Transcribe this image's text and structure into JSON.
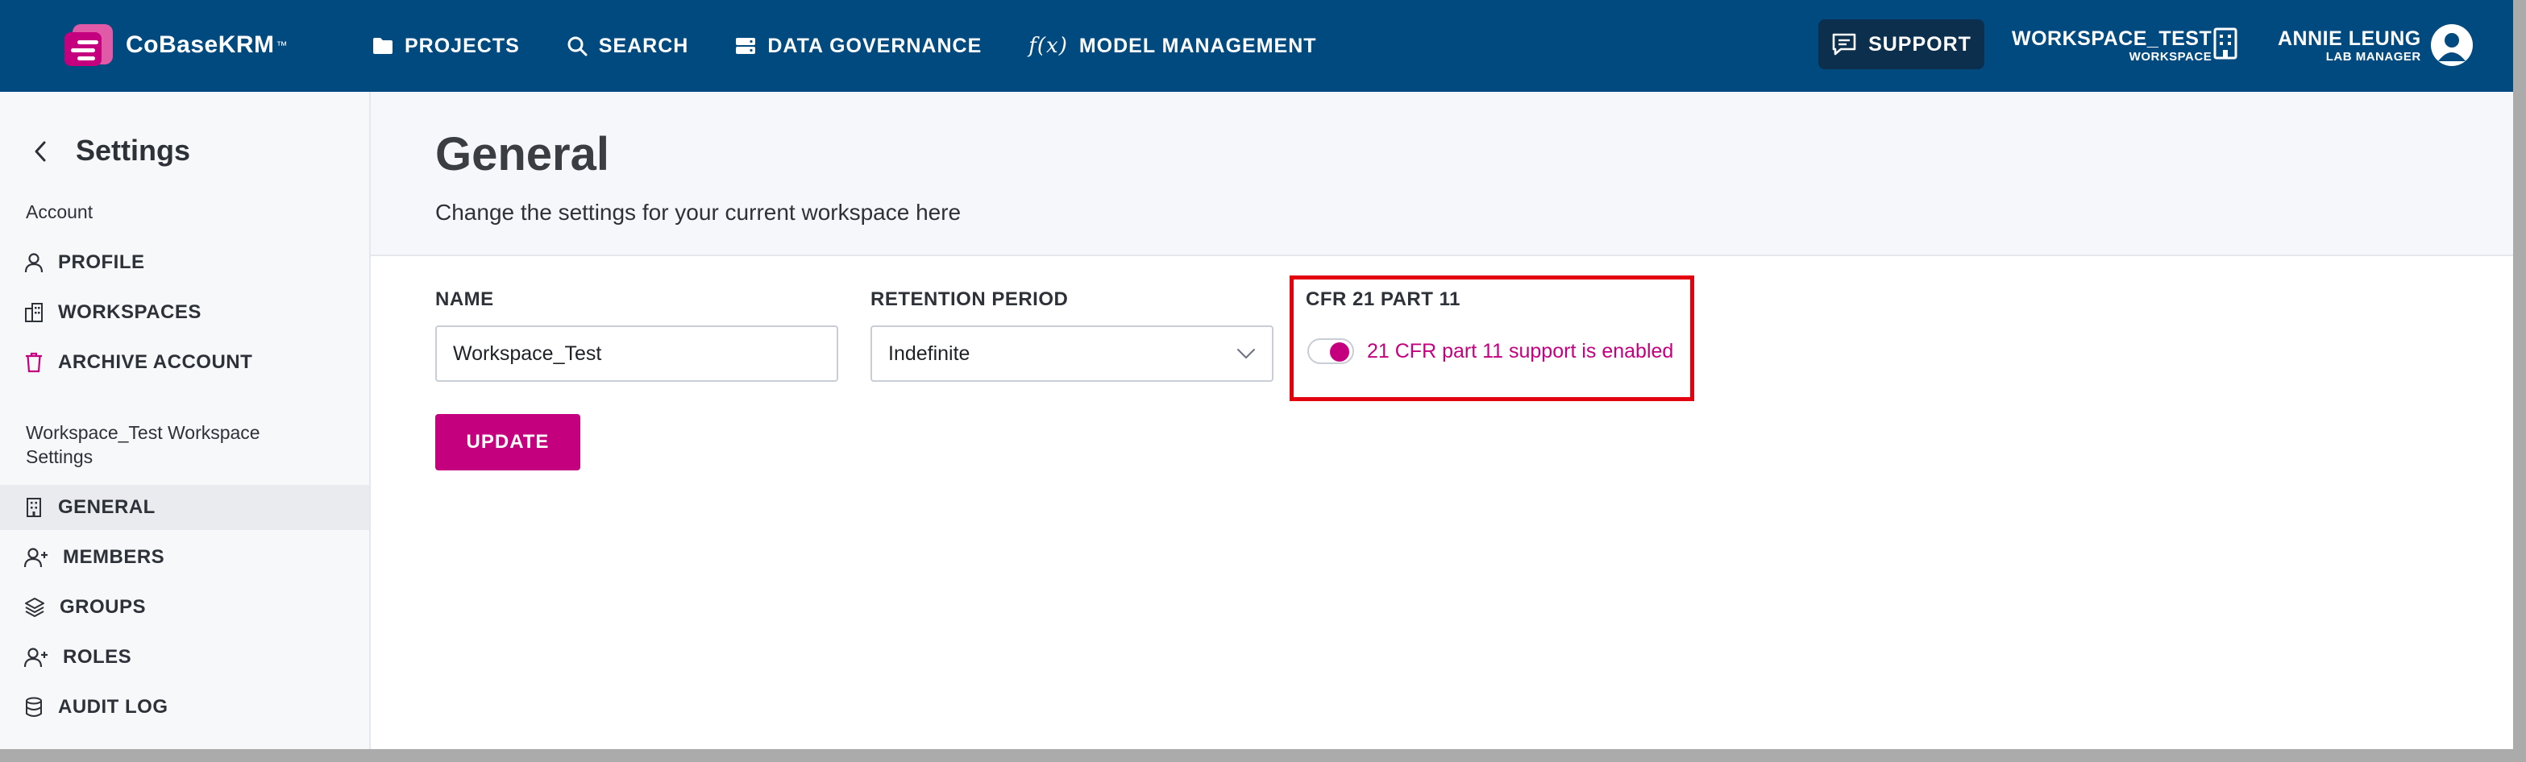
{
  "brand": {
    "name": "CoBaseKRM",
    "trademark": "™"
  },
  "nav": [
    {
      "label": "PROJECTS",
      "icon": "folder-icon"
    },
    {
      "label": "SEARCH",
      "icon": "search-icon"
    },
    {
      "label": "DATA GOVERNANCE",
      "icon": "database-icon"
    },
    {
      "label": "MODEL MANAGEMENT",
      "icon": "function-icon",
      "glyph": "f(x)"
    }
  ],
  "support": {
    "label": "SUPPORT",
    "icon": "chat-icon"
  },
  "workspace": {
    "name": "WORKSPACE_TEST",
    "sub": "WORKSPACE",
    "icon": "building-icon"
  },
  "user": {
    "name": "ANNIE LEUNG",
    "role": "LAB MANAGER"
  },
  "sidebar": {
    "title": "Settings",
    "account_heading": "Account",
    "account_items": [
      {
        "label": "PROFILE",
        "icon": "user-icon"
      },
      {
        "label": "WORKSPACES",
        "icon": "buildings-icon"
      },
      {
        "label": "ARCHIVE ACCOUNT",
        "icon": "trash-icon"
      }
    ],
    "workspace_heading": "Workspace_Test Workspace Settings",
    "workspace_items": [
      {
        "label": "GENERAL",
        "icon": "building-icon",
        "active": true
      },
      {
        "label": "MEMBERS",
        "icon": "user-plus-icon"
      },
      {
        "label": "GROUPS",
        "icon": "layers-icon"
      },
      {
        "label": "ROLES",
        "icon": "user-plus-icon"
      },
      {
        "label": "AUDIT LOG",
        "icon": "database-icon"
      }
    ]
  },
  "main": {
    "title": "General",
    "subtitle": "Change the settings for your current workspace here",
    "name_label": "NAME",
    "name_value": "Workspace_Test",
    "retention_label": "RETENTION PERIOD",
    "retention_value": "Indefinite",
    "cfr_label": "CFR 21 PART 11",
    "cfr_toggle_text": "21 CFR part 11 support is enabled",
    "cfr_enabled": true,
    "update_label": "UPDATE"
  },
  "colors": {
    "topbar": "#004a80",
    "accent": "#c5007f",
    "highlight": "#e3000f",
    "sidebar_bg": "#f7f8fa"
  }
}
